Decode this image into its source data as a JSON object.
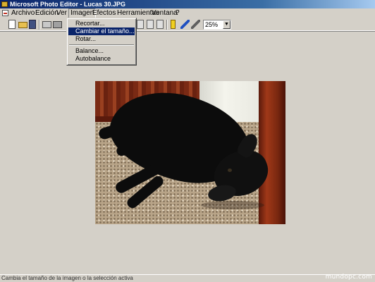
{
  "window": {
    "title": "Microsoft Photo Editor - Lucas 30.JPG"
  },
  "menubar": {
    "items": [
      "Archivo",
      "Edición",
      "Ver",
      "Imagen",
      "Efectos",
      "Herramientas",
      "Ventana",
      "?"
    ],
    "open_item": "Imagen"
  },
  "toolbar": {
    "zoom_value": "25%"
  },
  "dropdown": {
    "items": [
      "Recortar...",
      "Cambiar el tamaño...",
      "Rotar...",
      "Balance...",
      "Autobalance"
    ],
    "selected": "Cambiar el tamaño..."
  },
  "statusbar": {
    "text": "Cambia el tamaño de la imagen o la selección activa"
  },
  "watermark": {
    "text": "mundopc.com"
  },
  "colors": {
    "title_start": "#0a246a",
    "title_end": "#a6caf0",
    "menu_highlight": "#0a246a",
    "face": "#d4d0c8"
  }
}
